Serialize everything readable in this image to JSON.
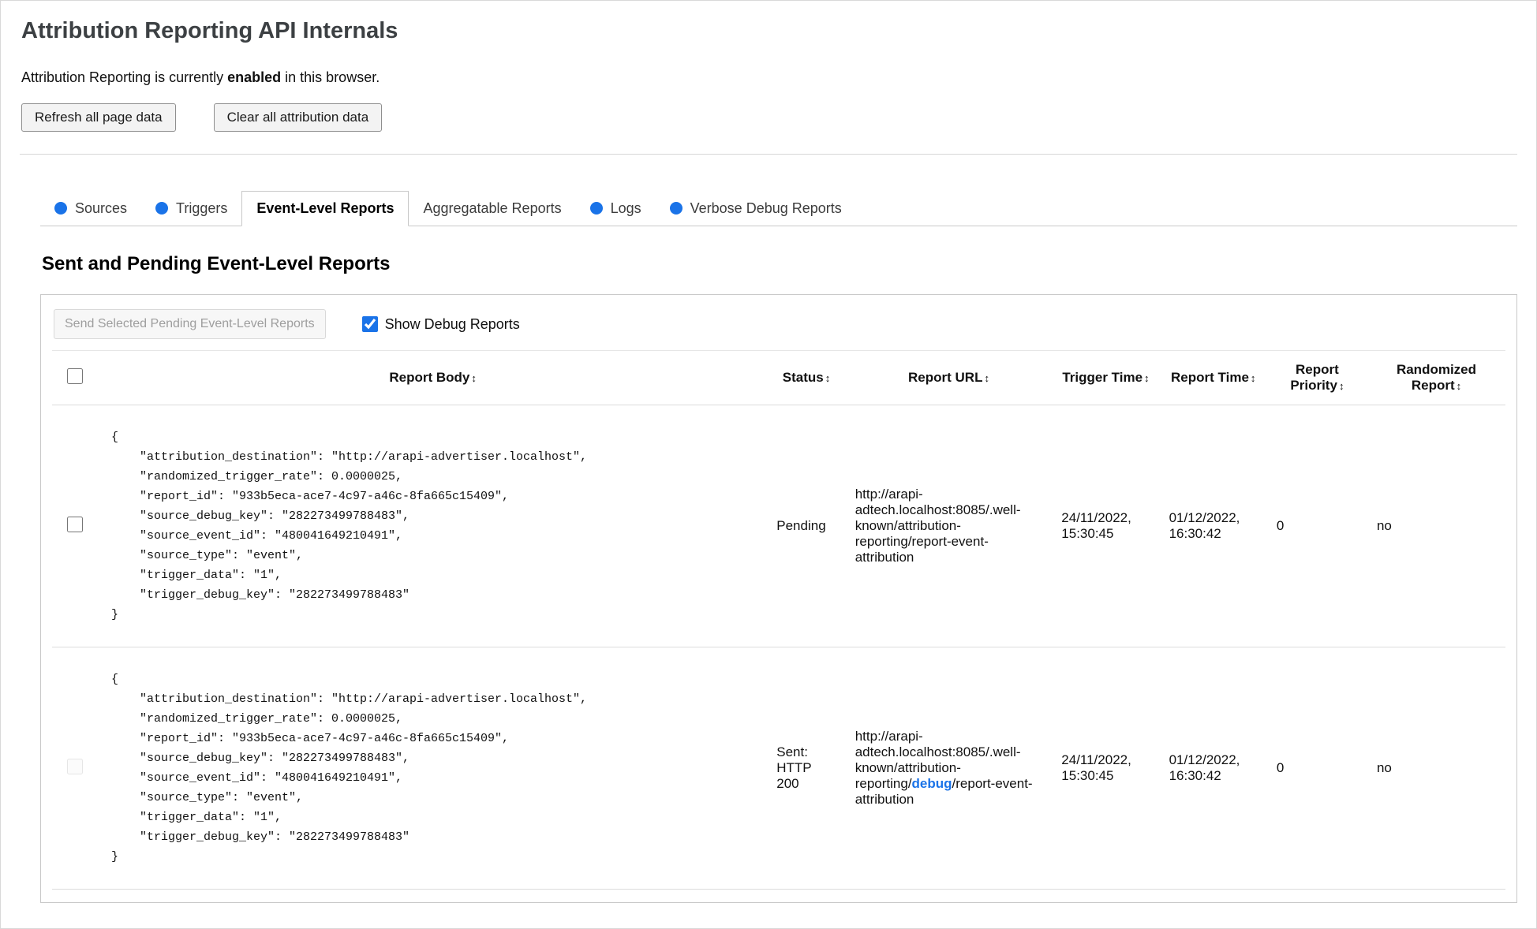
{
  "page": {
    "title": "Attribution Reporting API Internals",
    "status_prefix": "Attribution Reporting is currently ",
    "status_bold": "enabled",
    "status_suffix": " in this browser.",
    "refresh_button": "Refresh all page data",
    "clear_button": "Clear all attribution data"
  },
  "tabs": [
    {
      "label": "Sources",
      "has_dot": true,
      "active": false
    },
    {
      "label": "Triggers",
      "has_dot": true,
      "active": false
    },
    {
      "label": "Event-Level Reports",
      "has_dot": false,
      "active": true
    },
    {
      "label": "Aggregatable Reports",
      "has_dot": false,
      "active": false
    },
    {
      "label": "Logs",
      "has_dot": true,
      "active": false
    },
    {
      "label": "Verbose Debug Reports",
      "has_dot": true,
      "active": false
    }
  ],
  "colors": {
    "accent_blue": "#1a73e8",
    "debug_highlight": "#1a73e8"
  },
  "section": {
    "heading": "Sent and Pending Event-Level Reports",
    "send_button": "Send Selected Pending Event-Level Reports",
    "show_debug_label": "Show Debug Reports",
    "show_debug_checked": true
  },
  "table": {
    "sort_glyph": "↕",
    "headers": [
      {
        "label": "Report Body"
      },
      {
        "label": "Status"
      },
      {
        "label": "Report URL"
      },
      {
        "label": "Trigger Time"
      },
      {
        "label": "Report Time"
      },
      {
        "label": "Report Priority"
      },
      {
        "label": "Randomized Report"
      }
    ],
    "rows": [
      {
        "body": "{\n    \"attribution_destination\": \"http://arapi-advertiser.localhost\",\n    \"randomized_trigger_rate\": 0.0000025,\n    \"report_id\": \"933b5eca-ace7-4c97-a46c-8fa665c15409\",\n    \"source_debug_key\": \"282273499788483\",\n    \"source_event_id\": \"480041649210491\",\n    \"source_type\": \"event\",\n    \"trigger_data\": \"1\",\n    \"trigger_debug_key\": \"282273499788483\"\n}",
        "status": "Pending",
        "url": "http://arapi-adtech.localhost:8085/.well-known/attribution-reporting/report-event-attribution",
        "trigger_time": "24/11/2022, 15:30:45",
        "report_time": "01/12/2022, 16:30:42",
        "priority": "0",
        "randomized": "no"
      },
      {
        "checkbox_disabled": true,
        "body": "{\n    \"attribution_destination\": \"http://arapi-advertiser.localhost\",\n    \"randomized_trigger_rate\": 0.0000025,\n    \"report_id\": \"933b5eca-ace7-4c97-a46c-8fa665c15409\",\n    \"source_debug_key\": \"282273499788483\",\n    \"source_event_id\": \"480041649210491\",\n    \"source_type\": \"event\",\n    \"trigger_data\": \"1\",\n    \"trigger_debug_key\": \"282273499788483\"\n}",
        "status": "Sent: HTTP 200",
        "url_prefix": "http://arapi-adtech.localhost:8085/.well-known/attribution-reporting/",
        "url_debug": "debug",
        "url_suffix": "/report-event-attribution",
        "trigger_time": "24/11/2022, 15:30:45",
        "report_time": "01/12/2022, 16:30:42",
        "priority": "0",
        "randomized": "no"
      }
    ]
  }
}
